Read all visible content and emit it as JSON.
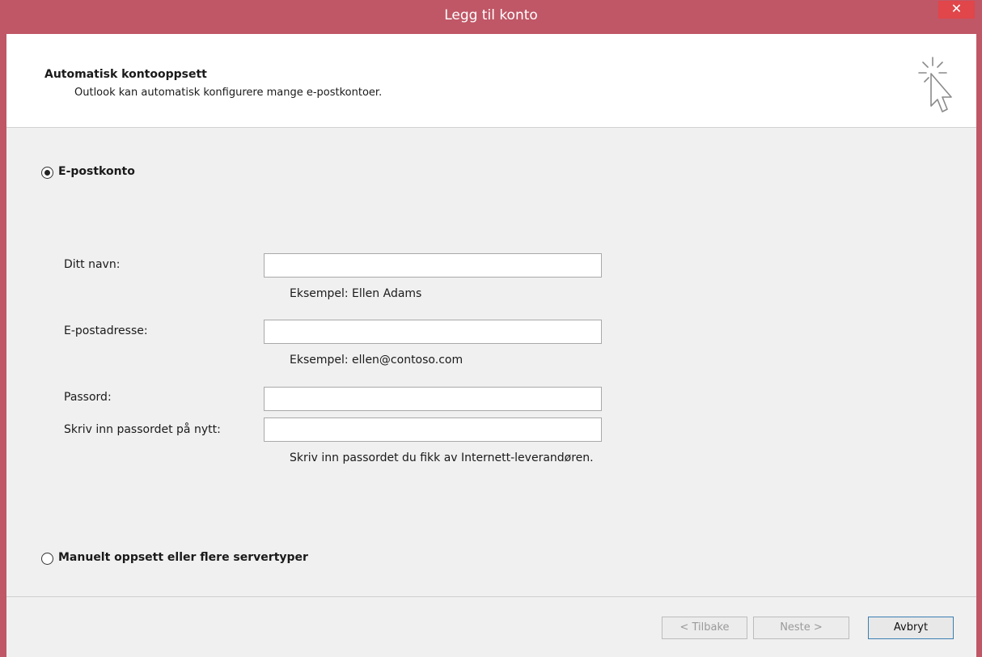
{
  "window": {
    "title": "Legg til konto",
    "close_label": "✕"
  },
  "header": {
    "title": "Automatisk kontooppsett",
    "subtitle": "Outlook kan automatisk konfigurere mange e-postkontoer."
  },
  "options": {
    "email_account": {
      "label": "E-postkonto",
      "selected": true
    },
    "manual_setup": {
      "label": "Manuelt oppsett eller flere servertyper",
      "selected": false
    }
  },
  "form": {
    "name": {
      "label": "Ditt navn:",
      "value": "",
      "hint": "Eksempel: Ellen Adams"
    },
    "email": {
      "label": "E-postadresse:",
      "value": "",
      "hint": "Eksempel: ellen@contoso.com"
    },
    "password": {
      "label": "Passord:",
      "value": ""
    },
    "password_repeat": {
      "label": "Skriv inn passordet på nytt:",
      "value": "",
      "hint": "Skriv inn passordet du fikk av Internett-leverandøren."
    }
  },
  "buttons": {
    "back": {
      "label": "< Tilbake",
      "enabled": false
    },
    "next": {
      "label": "Neste >",
      "enabled": false
    },
    "cancel": {
      "label": "Avbryt",
      "enabled": true
    }
  }
}
